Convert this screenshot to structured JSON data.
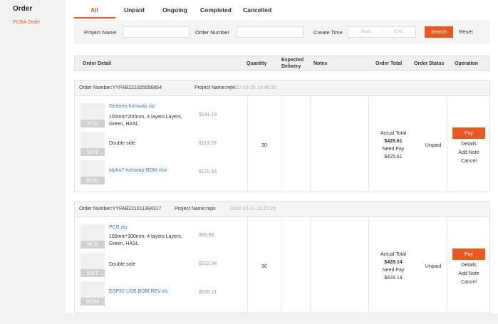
{
  "sidebar": {
    "title": "Order",
    "item": "PCBA Order"
  },
  "tabs": [
    {
      "label": "All"
    },
    {
      "label": "Unpaid"
    },
    {
      "label": "Ongoing"
    },
    {
      "label": "Completed"
    },
    {
      "label": "Cancelled"
    }
  ],
  "filters": {
    "project_name_label": "Project Name",
    "order_number_label": "Order Number",
    "create_time_label": "Create Time",
    "start_placeholder": "Start",
    "separator": "-",
    "end_placeholder": "End",
    "search_label": "Search",
    "reset_label": "Reset"
  },
  "columns": {
    "order_detail": "Order Detail",
    "quantity": "Quantity",
    "expected_delivery": "Expected Delivery",
    "notes": "Notes",
    "order_total": "Order Total",
    "order_status": "Order Status",
    "operation": "Operation"
  },
  "orders": [
    {
      "number": "Order Number:YYFAB221025556854",
      "project": "Project Name:mps",
      "time": "2022-10-25 14:40:20",
      "items": [
        {
          "thumb": "PCB",
          "desc": "Gerbers-hotswap.zip",
          "sub": "100mm*200mm, 4 layers Layers, Green, HASL",
          "price": "$141.19"
        },
        {
          "thumb": "SMT",
          "desc": "Double side",
          "price": "$113.78"
        },
        {
          "thumb": "BOM",
          "desc": "alpha7-hotswap-BOM.xlsx",
          "price": "$170.64"
        }
      ],
      "quantity": "30",
      "actual_total_label": "Actual Total",
      "actual_total": "$425.61",
      "need_pay_label": "Need Pay",
      "need_pay": "$425.61",
      "status": "Unpaid",
      "pay_label": "Pay",
      "details_label": "Details",
      "add_note_label": "Add Note",
      "cancel_label": "Cancel"
    },
    {
      "number": "Order Number:YYFAB221011394317",
      "project": "Project Name:mps",
      "time": "2022-10-11 11:22:25",
      "items": [
        {
          "thumb": "PCB",
          "desc": "PCB.zip",
          "sub": "100mm*100mm, 4 layers Layers, Green, HASL",
          "price": "$89.99"
        },
        {
          "thumb": "SMT",
          "desc": "Double side",
          "price": "$102.94"
        },
        {
          "thumb": "BOM",
          "desc": "ESP32-USB.BOM.REV.xls",
          "price": "$235.21"
        }
      ],
      "quantity": "30",
      "actual_total_label": "Actual Total",
      "actual_total": "$428.14",
      "need_pay_label": "Need Pay",
      "need_pay": "$428.14",
      "status": "Unpaid",
      "pay_label": "Pay",
      "details_label": "Details",
      "add_note_label": "Add Note",
      "cancel_label": "Cancel"
    }
  ]
}
